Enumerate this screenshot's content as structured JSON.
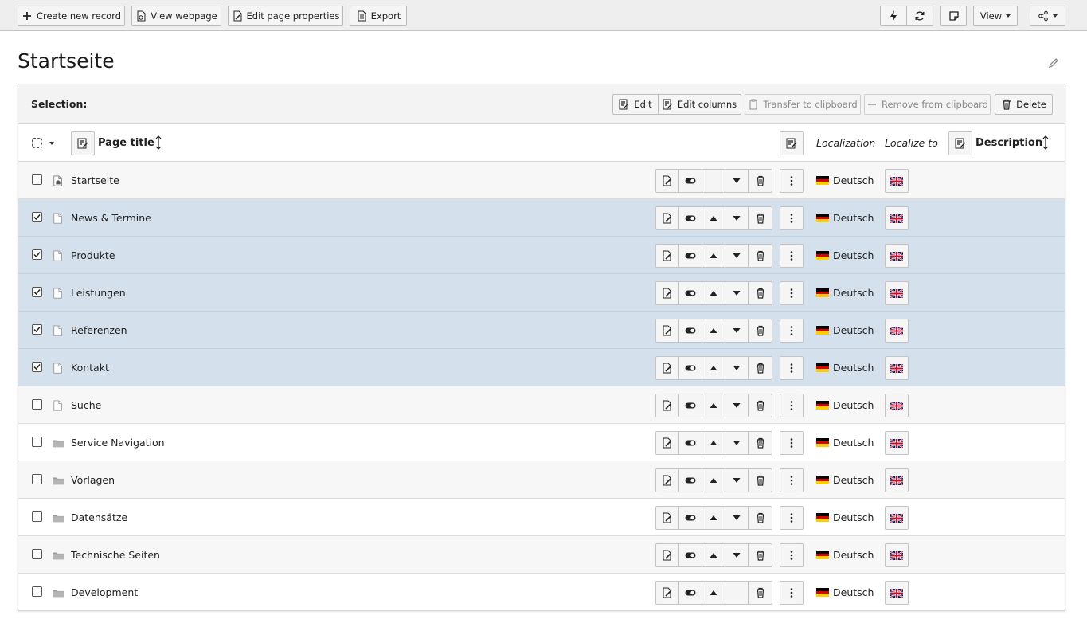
{
  "toolbar": {
    "create_new_record": "Create new record",
    "view_webpage": "View webpage",
    "edit_page_properties": "Edit page properties",
    "export": "Export",
    "view": "View"
  },
  "page": {
    "title": "Startseite"
  },
  "selection": {
    "label": "Selection:",
    "edit": "Edit",
    "edit_columns": "Edit columns",
    "transfer_to_clipboard": "Transfer to clipboard",
    "remove_from_clipboard": "Remove from clipboard",
    "delete": "Delete"
  },
  "columns": {
    "page_title": "Page title",
    "localization": "Localization",
    "localize_to": "Localize to",
    "description": "Description"
  },
  "rows": [
    {
      "title": "Startseite",
      "icon": "root-page-icon",
      "checked": false,
      "up": false,
      "down": true
    },
    {
      "title": "News & Termine",
      "icon": "page-icon",
      "checked": true,
      "up": true,
      "down": true
    },
    {
      "title": "Produkte",
      "icon": "page-icon",
      "checked": true,
      "up": true,
      "down": true
    },
    {
      "title": "Leistungen",
      "icon": "page-icon",
      "checked": true,
      "up": true,
      "down": true
    },
    {
      "title": "Referenzen",
      "icon": "page-icon",
      "checked": true,
      "up": true,
      "down": true
    },
    {
      "title": "Kontakt",
      "icon": "page-icon",
      "checked": true,
      "up": true,
      "down": true
    },
    {
      "title": "Suche",
      "icon": "page-icon",
      "checked": false,
      "up": true,
      "down": true
    },
    {
      "title": "Service Navigation",
      "icon": "folder-icon",
      "checked": false,
      "up": true,
      "down": true
    },
    {
      "title": "Vorlagen",
      "icon": "folder-icon",
      "checked": false,
      "up": true,
      "down": true
    },
    {
      "title": "Datensätze",
      "icon": "folder-icon",
      "checked": false,
      "up": true,
      "down": true
    },
    {
      "title": "Technische Seiten",
      "icon": "folder-icon",
      "checked": false,
      "up": true,
      "down": true
    },
    {
      "title": "Development",
      "icon": "folder-icon",
      "checked": false,
      "up": true,
      "down": false
    }
  ],
  "language": "Deutsch",
  "colors": {
    "selected_row": "#d4e1ec",
    "toolbar_bg": "#eeeeee"
  }
}
